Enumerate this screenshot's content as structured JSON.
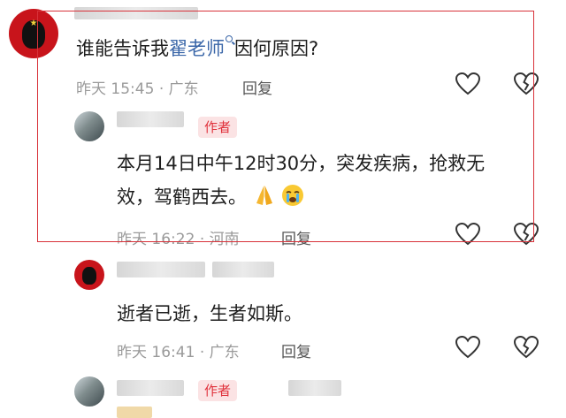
{
  "comments": [
    {
      "text_parts": [
        "谁能告诉我",
        "翟老师",
        "因何原因?"
      ],
      "time": "昨天 15:45",
      "location": "广东",
      "reply_label": "回复"
    },
    {
      "author_tag": "作者",
      "text_line1": "本月14日中午12时30分，突发疾病，抢救无",
      "text_line2": "效，驾鹤西去。",
      "time": "昨天 16:22",
      "location": "河南",
      "reply_label": "回复"
    },
    {
      "text": "逝者已逝，生者如斯。",
      "time": "昨天 16:41",
      "location": "广东",
      "reply_label": "回复"
    },
    {
      "author_tag": "作者"
    }
  ],
  "colors": {
    "highlight_border": "#d8323a",
    "link": "#3a66a8",
    "author_tag_bg": "#fbe3e4",
    "author_tag_text": "#e0323c",
    "meta": "#9a9a9a"
  },
  "icons": [
    "like-heart-icon",
    "dislike-broken-heart-icon",
    "search-icon",
    "praying-hands-emoji",
    "crying-face-emoji"
  ]
}
